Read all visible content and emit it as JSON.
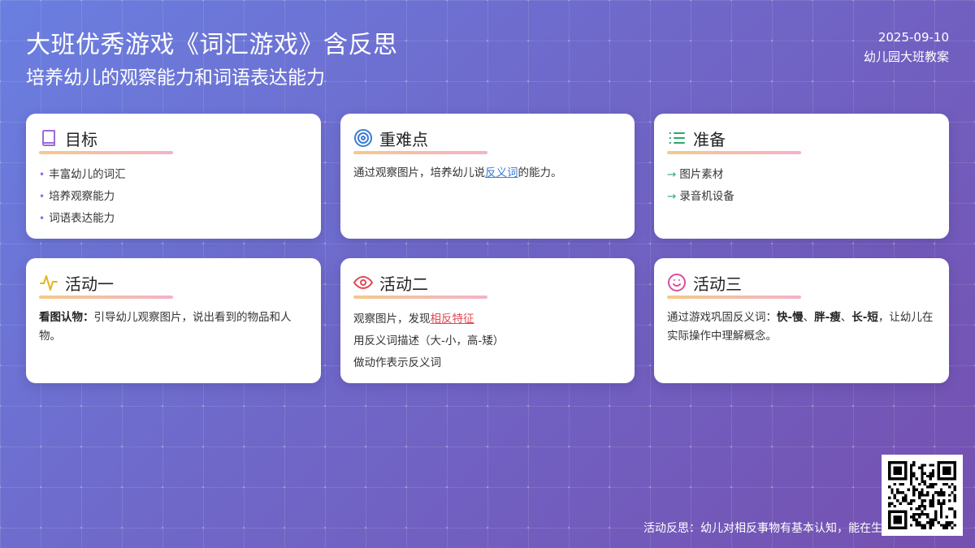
{
  "header": {
    "title": "大班优秀游戏《词汇游戏》含反思",
    "subtitle": "培养幼儿的观察能力和词语表达能力",
    "date": "2025-09-10",
    "category": "幼儿园大班教案"
  },
  "cards": {
    "goal": {
      "icon": "book-icon",
      "title": "目标",
      "items": [
        "丰富幼儿的词汇",
        "培养观察能力",
        "词语表达能力"
      ]
    },
    "focus": {
      "icon": "target-icon",
      "title": "重难点",
      "text_before": "通过观察图片，培养幼儿说",
      "link": "反义词",
      "text_after": "的能力。"
    },
    "prep": {
      "icon": "list-icon",
      "title": "准备",
      "items": [
        "图片素材",
        "录音机设备"
      ]
    },
    "activity1": {
      "icon": "pulse-icon",
      "title": "活动一",
      "bold": "看图认物：",
      "text": "引导幼儿观察图片，说出看到的物品和人物。"
    },
    "activity2": {
      "icon": "eye-icon",
      "title": "活动二",
      "line1_before": "观察图片，发现",
      "line1_link": "相反特征",
      "line2": "用反义词描述（大-小，高-矮）",
      "line3": "做动作表示反义词"
    },
    "activity3": {
      "icon": "smile-icon",
      "title": "活动三",
      "text_before": "通过游戏巩固反义词：",
      "word1": "快-慢",
      "sep1": "、",
      "word2": "胖-瘦",
      "sep2": "、",
      "word3": "长-短",
      "text_after": "，让幼儿在实际操作中理解概念。"
    }
  },
  "footer": {
    "reflection": "活动反思：幼儿对相反事物有基本认知，能在生"
  },
  "colors": {
    "goal_icon": "#9b6bd8",
    "focus_icon": "#3b7bd4",
    "prep_icon": "#2ea86a",
    "activity1_icon": "#e6b21f",
    "activity2_icon": "#e04a55",
    "activity3_icon": "#d94fa0"
  }
}
